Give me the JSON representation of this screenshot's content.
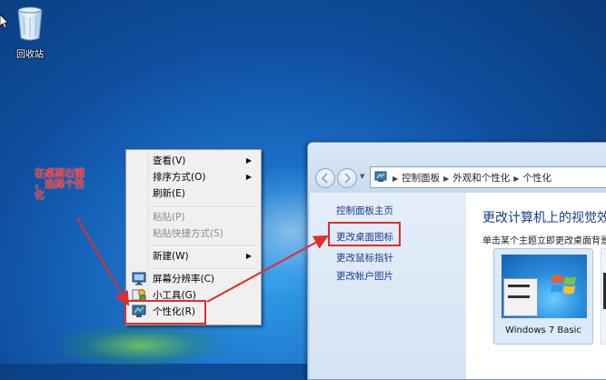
{
  "desktop": {
    "recycle_bin_label": "回收站"
  },
  "annotation": {
    "line1": "在桌面右键",
    "line2": "，选择个性",
    "line3": "化"
  },
  "context_menu": {
    "items": [
      {
        "label": "查看(V)",
        "submenu": true
      },
      {
        "label": "排序方式(O)",
        "submenu": true
      },
      {
        "label": "刷新(E)"
      },
      {
        "label": "粘贴(P)",
        "disabled": true
      },
      {
        "label": "粘贴快捷方式(S)",
        "disabled": true
      },
      {
        "label": "新建(W)",
        "submenu": true
      },
      {
        "label": "屏幕分辨率(C)",
        "icon": "monitor-icon"
      },
      {
        "label": "小工具(G)",
        "icon": "gadgets-icon"
      },
      {
        "label": "个性化(R)",
        "icon": "personalize-icon"
      }
    ]
  },
  "window": {
    "breadcrumb": [
      "控制面板",
      "外观和个性化",
      "个性化"
    ],
    "left_links": [
      "控制面板主页",
      "更改桌面图标",
      "更改鼠标指针",
      "更改帐户图片"
    ],
    "heading": "更改计算机上的视觉效",
    "subtext": "单击某个主题立即更改桌面背景",
    "theme_name": "Windows 7 Basic"
  },
  "colors": {
    "accent_red": "#e02d2d",
    "link_blue": "#1a3b8f"
  }
}
